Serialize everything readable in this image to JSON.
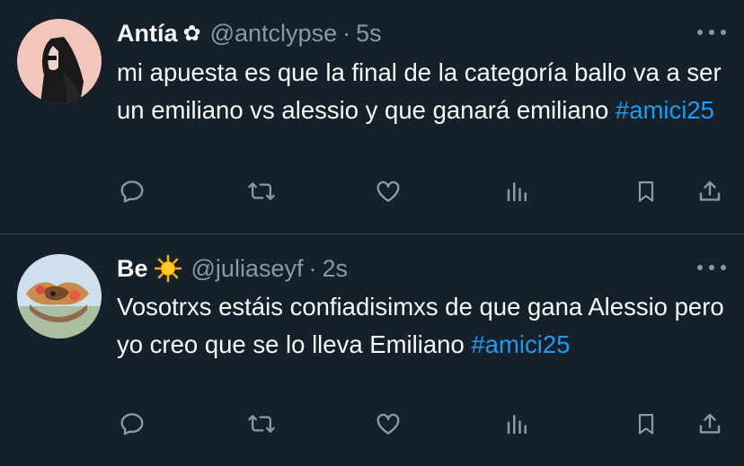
{
  "tweets": [
    {
      "display_name": "Antía",
      "name_decoration": "✿",
      "handle": "@antclypse",
      "separator": "·",
      "time": "5s",
      "text": "mi apuesta es que la final de la categoría ballo va a ser un emiliano vs alessio y que ganará emiliano",
      "hashtag": "#amici25"
    },
    {
      "display_name": "Be",
      "name_decoration": "sun-emoji",
      "handle": "@juliaseyf",
      "separator": "·",
      "time": "2s",
      "text": "Vosotrxs estáis confiadisimxs de que gana Alessio pero yo creo que se lo lleva Emiliano",
      "hashtag": "#amici25"
    }
  ],
  "icons": [
    "reply-icon",
    "retweet-icon",
    "like-icon",
    "views-icon",
    "bookmark-icon",
    "share-icon",
    "more-icon"
  ],
  "colors": {
    "background": "#15202b",
    "text": "#f7f9f9",
    "muted": "#8b98a5",
    "hashtag": "#1d9bf0",
    "divider": "#38444d"
  }
}
